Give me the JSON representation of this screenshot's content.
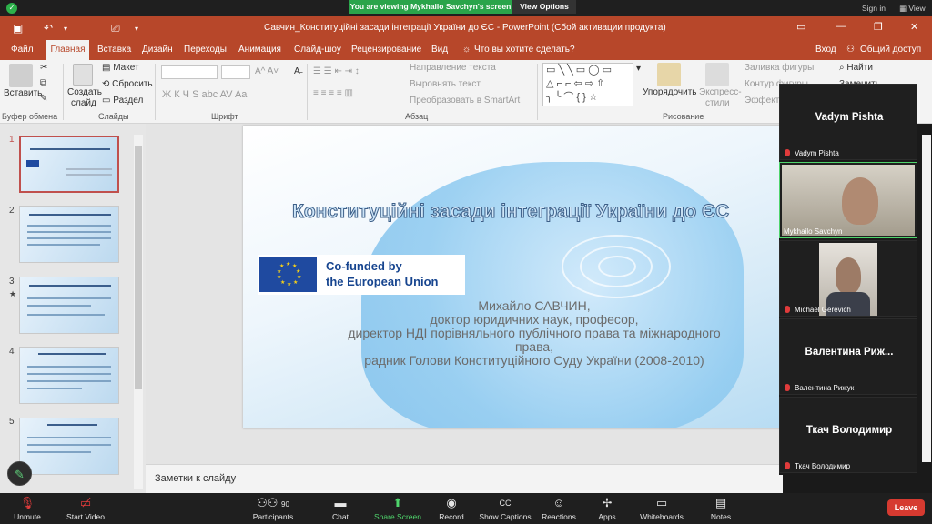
{
  "zoom": {
    "banner": "You are viewing Mykhailo Savchyn's screen",
    "view_options": "View Options",
    "sign_in": "Sign in",
    "view": "View",
    "bottom": {
      "unmute": "Unmute",
      "start_video": "Start Video",
      "participants": "Participants",
      "participants_count": "90",
      "chat": "Chat",
      "share": "Share Screen",
      "record": "Record",
      "captions": "Show Captions",
      "reactions": "Reactions",
      "apps": "Apps",
      "whiteboards": "Whiteboards",
      "notes": "Notes",
      "leave": "Leave"
    },
    "participants": [
      {
        "display": "Vadym Pishta",
        "name": "Vadym Pishta"
      },
      {
        "display": "",
        "name": "Mykhailo Savchyn"
      },
      {
        "display": "",
        "name": "Michael Gerevich"
      },
      {
        "display": "Валентина  Риж...",
        "name": "Валентина Рижук"
      },
      {
        "display": "Ткач Володимир",
        "name": "Ткач Володимир"
      }
    ]
  },
  "ppt": {
    "title": "Савчин_Конституційні засади інтеграції України до ЄС  -  PowerPoint (Сбой активации продукта)",
    "menu": {
      "file": "Файл",
      "home": "Главная",
      "insert": "Вставка",
      "design": "Дизайн",
      "transitions": "Переходы",
      "animation": "Анимация",
      "slideshow": "Слайд-шоу",
      "review": "Рецензирование",
      "view": "Вид",
      "tell": "Что вы хотите сделать?",
      "signin": "Вход",
      "share": "Общий доступ"
    },
    "ribbon": {
      "paste": "Вставить",
      "clipboard": "Буфер обмена",
      "new_slide_1": "Создать",
      "new_slide_2": "слайд",
      "layout": "Макет",
      "reset": "Сбросить",
      "section": "Раздел",
      "slides": "Слайды",
      "font_group": "Шрифт",
      "font_buttons": "Ж  К  Ч  S  abc  AV  Aa",
      "paragraph_group": "Абзац",
      "text_dir": "Направление текста",
      "align_text": "Выровнять текст",
      "smartart": "Преобразовать в SmartArt",
      "arrange": "Упорядочить",
      "quick_1": "Экспресс-",
      "quick_2": "стили",
      "drawing": "Рисование",
      "fill": "Заливка фигуры",
      "outline": "Контур фигуры",
      "effects": "Эффекты",
      "find": "Найти",
      "replace": "Заменить"
    },
    "slides": [
      "1",
      "2",
      "3",
      "4",
      "5"
    ],
    "notes": "Заметки к слайду",
    "slide": {
      "title": "Конституційні засади інтеграції України до ЄС",
      "eu_line1": "Co-funded by",
      "eu_line2": "the European Union",
      "author_lines": [
        "Михайло САВЧИН,",
        "доктор юридичних наук, професор,",
        "директор НДІ порівняльного публічного права та міжнародного",
        "права,",
        "радник Голови Конституційного Суду України (2008-2010)"
      ]
    }
  },
  "colors": {
    "accent": "#b7472a",
    "zoom_green": "#2aa44a",
    "leave": "#d63a30",
    "eu_blue": "#1f4aa0"
  }
}
